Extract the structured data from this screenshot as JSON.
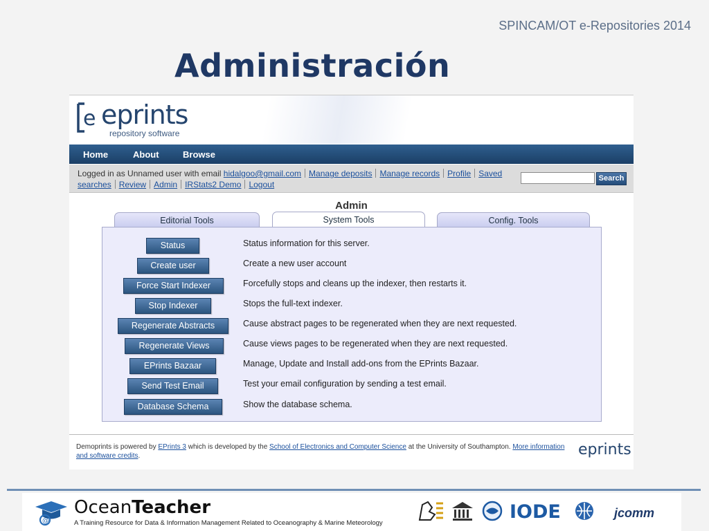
{
  "slide": {
    "header": "SPINCAM/OT e-Repositories 2014",
    "title": "Administración"
  },
  "eprints": {
    "logo_text": "eprints",
    "logo_sub": "repository software",
    "nav": [
      "Home",
      "About",
      "Browse"
    ],
    "user": {
      "prefix": "Logged in as Unnamed user with email",
      "email": "hidalgoo@gmail.com",
      "links_row1": [
        "Manage deposits",
        "Manage records",
        "Profile",
        "Saved"
      ],
      "links_row2": [
        "searches",
        "Review",
        "Admin",
        "IRStats2 Demo",
        "Logout"
      ]
    },
    "search": {
      "button": "Search",
      "placeholder": ""
    },
    "admin_title": "Admin",
    "tabs": [
      "Editorial Tools",
      "System Tools",
      "Config. Tools"
    ],
    "active_tab": "System Tools",
    "tools": [
      {
        "label": "Status",
        "desc": "Status information for this server."
      },
      {
        "label": "Create user",
        "desc": "Create a new user account"
      },
      {
        "label": "Force Start Indexer",
        "desc": "Forcefully stops and cleans up the indexer, then restarts it."
      },
      {
        "label": "Stop Indexer",
        "desc": "Stops the full-text indexer."
      },
      {
        "label": "Regenerate Abstracts",
        "desc": "Cause abstract pages to be regenerated when they are next requested."
      },
      {
        "label": "Regenerate Views",
        "desc": "Cause views pages to be regenerated when they are next requested."
      },
      {
        "label": "EPrints Bazaar",
        "desc": "Manage, Update and Install add-ons from the EPrints Bazaar."
      },
      {
        "label": "Send Test Email",
        "desc": "Test your email configuration by sending a test email."
      },
      {
        "label": "Database Schema",
        "desc": "Show the database schema."
      }
    ],
    "footer": {
      "t1": "Demoprints is powered by ",
      "l1": "EPrints 3",
      "t2": " which is developed by the ",
      "l2": "School of Electronics and Computer Science",
      "t3": " at the University of Southampton. ",
      "l3": "More information",
      "l4": "and software credits",
      "t4": ".",
      "logo": "eprints"
    }
  },
  "bottom": {
    "brand_plain": "Ocean",
    "brand_bold": "Teacher",
    "tagline": "A Training Resource for Data & Information Management Related to Oceanography & Marine Meteorology",
    "iode": "IODE",
    "jcomm": "jcomm"
  },
  "colors": {
    "title": "#1f3864",
    "nav_bar": "#1b3f66",
    "button": "#2c557f",
    "panel": "#ececfb",
    "link": "#1a4f9c"
  }
}
